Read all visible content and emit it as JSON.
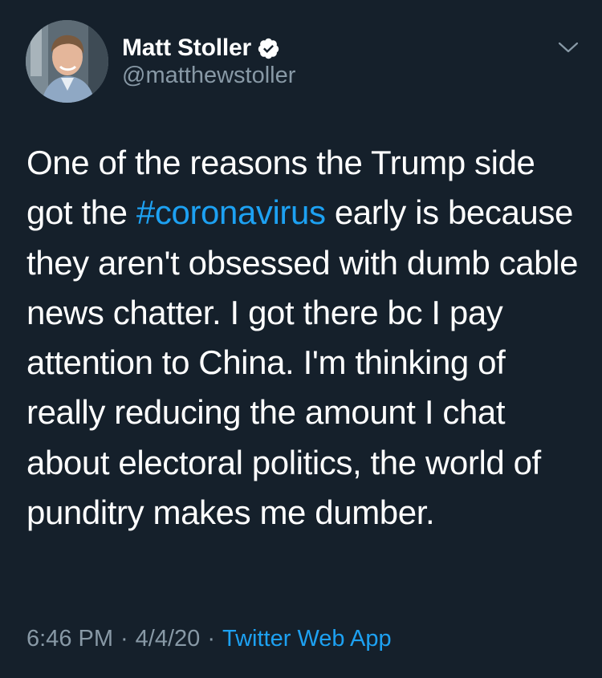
{
  "author": {
    "display_name": "Matt Stoller",
    "handle": "@matthewstoller",
    "verified": true,
    "avatar_icon": "profile-photo"
  },
  "menu": {
    "icon": "chevron-down-icon"
  },
  "tweet": {
    "text_before": "One of the reasons the Trump side got the ",
    "hashtag": "#coronavirus",
    "text_after": " early is because they aren't obsessed with dumb cable news chatter. I got there bc I pay attention to China. I'm thinking of really reducing the amount I chat about electoral politics, the world of punditry makes me dumber."
  },
  "meta": {
    "time": "6:46 PM",
    "separator": "·",
    "date": "4/4/20",
    "source": "Twitter Web App"
  },
  "colors": {
    "background": "#15202b",
    "text": "#ffffff",
    "secondary": "#8899a6",
    "link": "#1da1f2"
  }
}
